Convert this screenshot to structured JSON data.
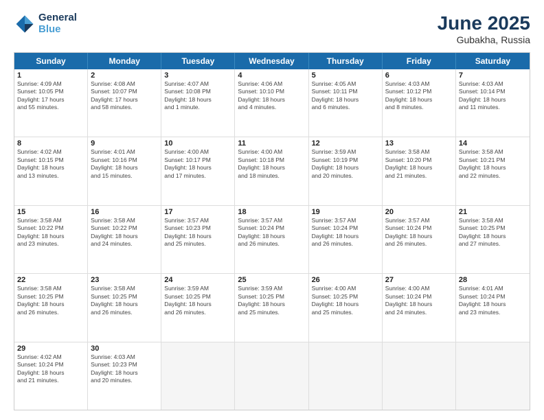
{
  "logo": {
    "line1": "General",
    "line2": "Blue"
  },
  "title": {
    "month_year": "June 2025",
    "location": "Gubakha, Russia"
  },
  "header_days": [
    "Sunday",
    "Monday",
    "Tuesday",
    "Wednesday",
    "Thursday",
    "Friday",
    "Saturday"
  ],
  "rows": [
    [
      {
        "day": "1",
        "info": "Sunrise: 4:09 AM\nSunset: 10:05 PM\nDaylight: 17 hours\nand 55 minutes."
      },
      {
        "day": "2",
        "info": "Sunrise: 4:08 AM\nSunset: 10:07 PM\nDaylight: 17 hours\nand 58 minutes."
      },
      {
        "day": "3",
        "info": "Sunrise: 4:07 AM\nSunset: 10:08 PM\nDaylight: 18 hours\nand 1 minute."
      },
      {
        "day": "4",
        "info": "Sunrise: 4:06 AM\nSunset: 10:10 PM\nDaylight: 18 hours\nand 4 minutes."
      },
      {
        "day": "5",
        "info": "Sunrise: 4:05 AM\nSunset: 10:11 PM\nDaylight: 18 hours\nand 6 minutes."
      },
      {
        "day": "6",
        "info": "Sunrise: 4:03 AM\nSunset: 10:12 PM\nDaylight: 18 hours\nand 8 minutes."
      },
      {
        "day": "7",
        "info": "Sunrise: 4:03 AM\nSunset: 10:14 PM\nDaylight: 18 hours\nand 11 minutes."
      }
    ],
    [
      {
        "day": "8",
        "info": "Sunrise: 4:02 AM\nSunset: 10:15 PM\nDaylight: 18 hours\nand 13 minutes."
      },
      {
        "day": "9",
        "info": "Sunrise: 4:01 AM\nSunset: 10:16 PM\nDaylight: 18 hours\nand 15 minutes."
      },
      {
        "day": "10",
        "info": "Sunrise: 4:00 AM\nSunset: 10:17 PM\nDaylight: 18 hours\nand 17 minutes."
      },
      {
        "day": "11",
        "info": "Sunrise: 4:00 AM\nSunset: 10:18 PM\nDaylight: 18 hours\nand 18 minutes."
      },
      {
        "day": "12",
        "info": "Sunrise: 3:59 AM\nSunset: 10:19 PM\nDaylight: 18 hours\nand 20 minutes."
      },
      {
        "day": "13",
        "info": "Sunrise: 3:58 AM\nSunset: 10:20 PM\nDaylight: 18 hours\nand 21 minutes."
      },
      {
        "day": "14",
        "info": "Sunrise: 3:58 AM\nSunset: 10:21 PM\nDaylight: 18 hours\nand 22 minutes."
      }
    ],
    [
      {
        "day": "15",
        "info": "Sunrise: 3:58 AM\nSunset: 10:22 PM\nDaylight: 18 hours\nand 23 minutes."
      },
      {
        "day": "16",
        "info": "Sunrise: 3:58 AM\nSunset: 10:22 PM\nDaylight: 18 hours\nand 24 minutes."
      },
      {
        "day": "17",
        "info": "Sunrise: 3:57 AM\nSunset: 10:23 PM\nDaylight: 18 hours\nand 25 minutes."
      },
      {
        "day": "18",
        "info": "Sunrise: 3:57 AM\nSunset: 10:24 PM\nDaylight: 18 hours\nand 26 minutes."
      },
      {
        "day": "19",
        "info": "Sunrise: 3:57 AM\nSunset: 10:24 PM\nDaylight: 18 hours\nand 26 minutes."
      },
      {
        "day": "20",
        "info": "Sunrise: 3:57 AM\nSunset: 10:24 PM\nDaylight: 18 hours\nand 26 minutes."
      },
      {
        "day": "21",
        "info": "Sunrise: 3:58 AM\nSunset: 10:25 PM\nDaylight: 18 hours\nand 27 minutes."
      }
    ],
    [
      {
        "day": "22",
        "info": "Sunrise: 3:58 AM\nSunset: 10:25 PM\nDaylight: 18 hours\nand 26 minutes."
      },
      {
        "day": "23",
        "info": "Sunrise: 3:58 AM\nSunset: 10:25 PM\nDaylight: 18 hours\nand 26 minutes."
      },
      {
        "day": "24",
        "info": "Sunrise: 3:59 AM\nSunset: 10:25 PM\nDaylight: 18 hours\nand 26 minutes."
      },
      {
        "day": "25",
        "info": "Sunrise: 3:59 AM\nSunset: 10:25 PM\nDaylight: 18 hours\nand 25 minutes."
      },
      {
        "day": "26",
        "info": "Sunrise: 4:00 AM\nSunset: 10:25 PM\nDaylight: 18 hours\nand 25 minutes."
      },
      {
        "day": "27",
        "info": "Sunrise: 4:00 AM\nSunset: 10:24 PM\nDaylight: 18 hours\nand 24 minutes."
      },
      {
        "day": "28",
        "info": "Sunrise: 4:01 AM\nSunset: 10:24 PM\nDaylight: 18 hours\nand 23 minutes."
      }
    ],
    [
      {
        "day": "29",
        "info": "Sunrise: 4:02 AM\nSunset: 10:24 PM\nDaylight: 18 hours\nand 21 minutes."
      },
      {
        "day": "30",
        "info": "Sunrise: 4:03 AM\nSunset: 10:23 PM\nDaylight: 18 hours\nand 20 minutes."
      },
      {
        "day": "",
        "info": ""
      },
      {
        "day": "",
        "info": ""
      },
      {
        "day": "",
        "info": ""
      },
      {
        "day": "",
        "info": ""
      },
      {
        "day": "",
        "info": ""
      }
    ]
  ]
}
